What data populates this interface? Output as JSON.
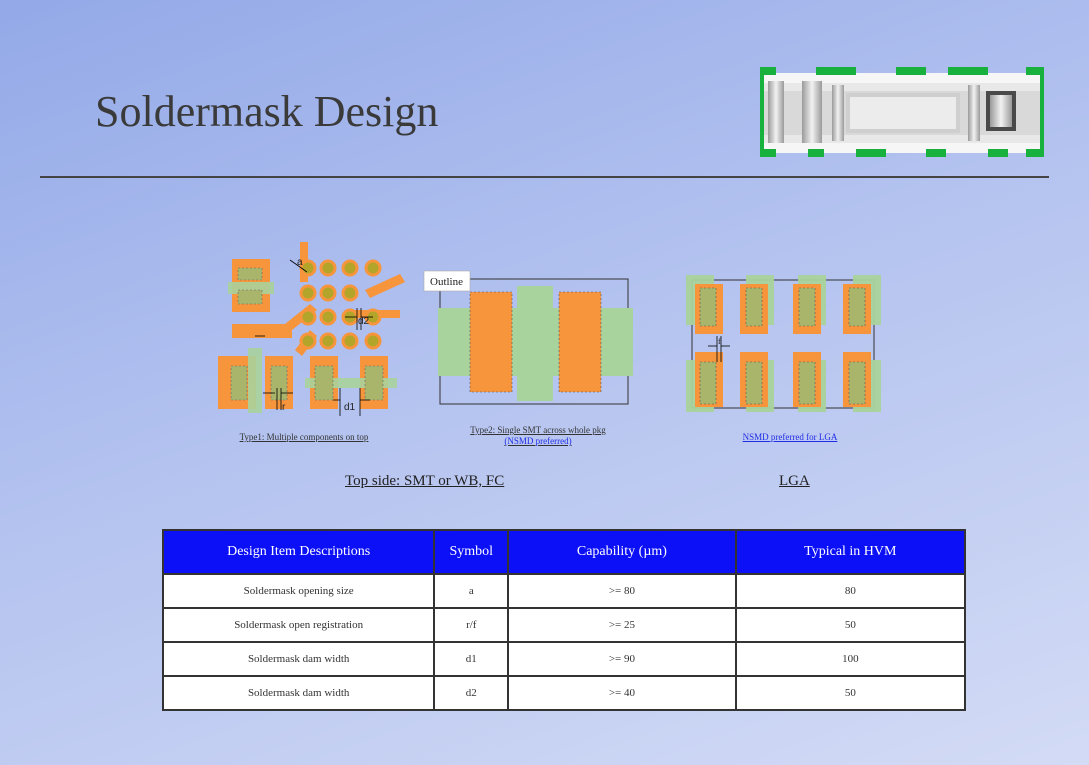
{
  "slide": {
    "title": "Soldermask Design"
  },
  "figures": {
    "type1": {
      "caption": "Type1: Multiple components on top",
      "labels": {
        "a": "a",
        "d2": "d2",
        "r": "r",
        "d1": "d1"
      }
    },
    "type2": {
      "caption_line1": "Type2: Single SMT across whole pkg",
      "caption_line2": "(NSMD preferred)",
      "outline_label": "Outline"
    },
    "lga": {
      "caption": "NSMD preferred for LGA",
      "label_f": "f"
    }
  },
  "subtitles": {
    "left": "Top side: SMT or WB, FC",
    "right": "LGA"
  },
  "table": {
    "headers": [
      "Design Item Descriptions",
      "Symbol",
      "Capability (µm)",
      "Typical in HVM"
    ],
    "rows": [
      [
        "Soldermask opening size",
        "a",
        ">= 80",
        "80"
      ],
      [
        "Soldermask open registration",
        "r/f",
        ">= 25",
        "50"
      ],
      [
        "Soldermask dam width",
        "d1",
        ">= 90",
        "100"
      ],
      [
        "Soldermask dam width",
        "d2",
        ">= 40",
        "50"
      ]
    ]
  },
  "colors": {
    "pad_orange": "#f7953d",
    "mask_green": "#a9d39c",
    "header_blue": "#0c10f6",
    "via_olive": "#b3a52a"
  }
}
